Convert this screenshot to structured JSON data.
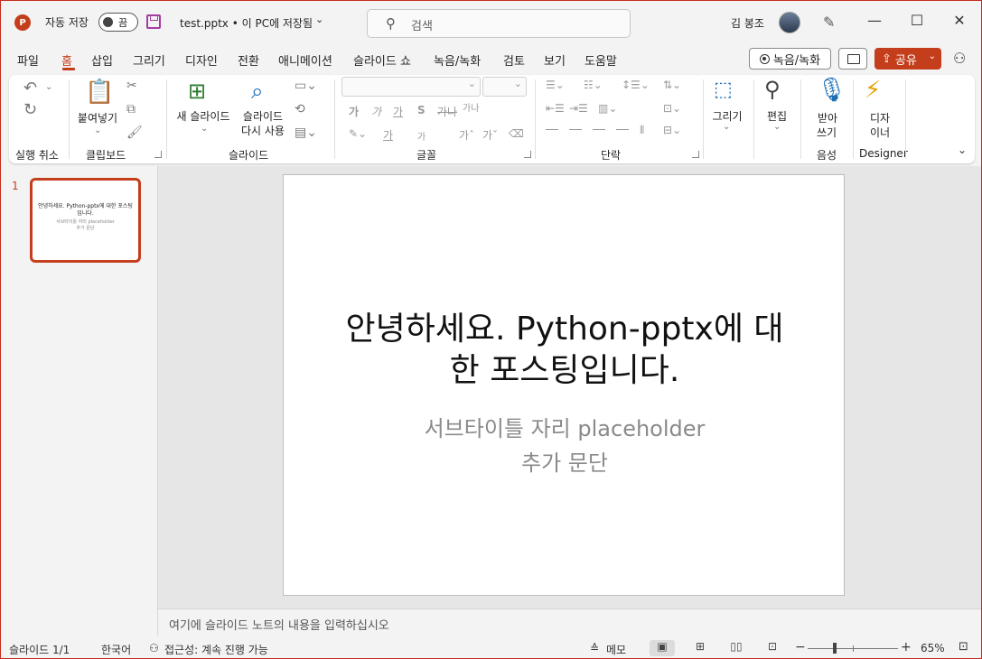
{
  "titlebar": {
    "app_logo": "P",
    "autosave_label": "자동 저장",
    "autosave_state": "끔",
    "doc_title": "test.pptx • 이 PC에 저장됨",
    "search_placeholder": "검색",
    "user_name": "김 봉조",
    "minimize": "—",
    "maximize": "☐",
    "close": "✕"
  },
  "menu": {
    "tabs": [
      "파일",
      "홈",
      "삽입",
      "그리기",
      "디자인",
      "전환",
      "애니메이션",
      "슬라이드 쇼",
      "녹음/녹화",
      "검토",
      "보기",
      "도움말"
    ],
    "active_tab": "홈",
    "record_label": "녹음/녹화",
    "share_label": "공유"
  },
  "ribbon": {
    "groups": {
      "undo": "실행 취소",
      "clipboard": "클립보드",
      "slides": "슬라이드",
      "font": "글꼴",
      "paragraph": "단락",
      "voice": "음성",
      "designer": "Designer"
    },
    "paste": "붙여넣기",
    "new_slide": "새 슬라이드",
    "reuse_slide_1": "슬라이드",
    "reuse_slide_2": "다시 사용",
    "draw": "그리기",
    "edit": "편집",
    "dictate_1": "받아",
    "dictate_2": "쓰기",
    "designer_1": "디자",
    "designer_2": "이너",
    "font_buttons": [
      "가",
      "가",
      "가",
      "S",
      "가나",
      "가나"
    ],
    "font_row3": [
      "가",
      "가"
    ]
  },
  "thumbnails": [
    {
      "number": "1",
      "title": "안녕하세요. Python-pptx에 대한 포스팅입니다.",
      "subtitle_1": "서브타이틀 자리 placeholder",
      "subtitle_2": "추가 문단"
    }
  ],
  "slide": {
    "title_line1": "안녕하세요. Python-pptx에 대",
    "title_line2": "한 포스팅입니다.",
    "subtitle_line1": "서브타이틀 자리 placeholder",
    "subtitle_line2": "추가 문단"
  },
  "notes_placeholder": "여기에 슬라이드 노트의 내용을 입력하십시오",
  "statusbar": {
    "slide_position": "슬라이드 1/1",
    "language": "한국어",
    "accessibility": "접근성: 계속 진행 가능",
    "notes_button": "메모",
    "zoom_minus": "−",
    "zoom_plus": "+",
    "zoom_level": "65%",
    "zoom_fraction": 0.3
  },
  "colors": {
    "accent": "#c43e1c",
    "window_border": "#c42b1c"
  }
}
